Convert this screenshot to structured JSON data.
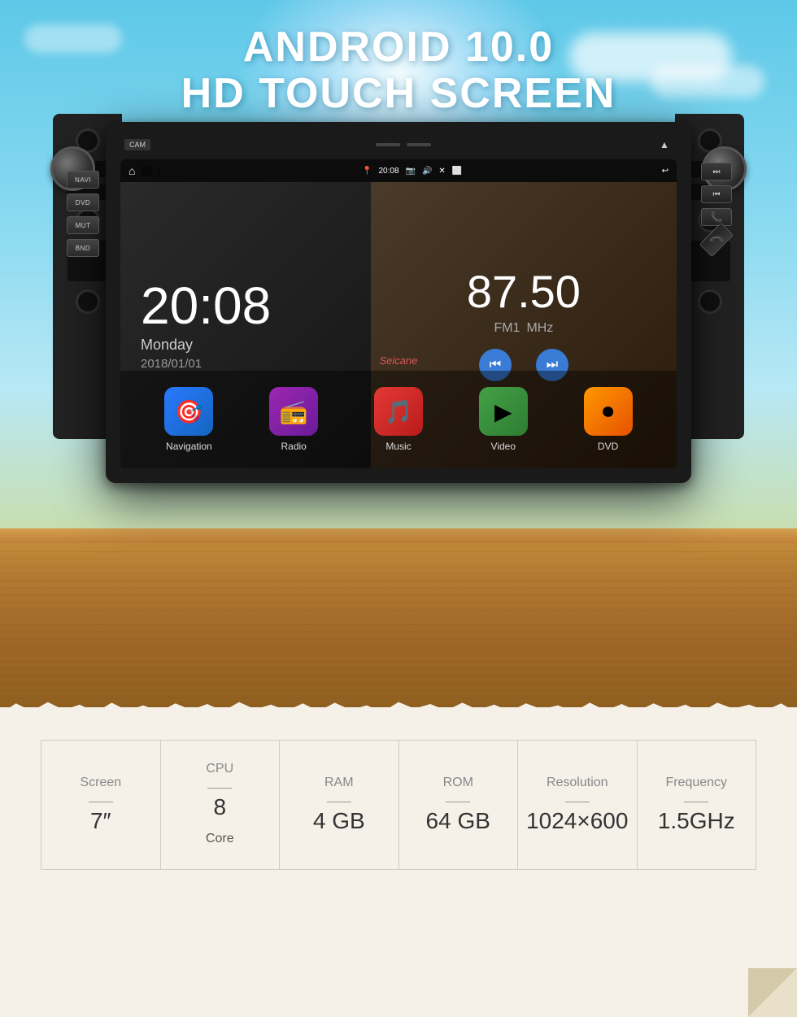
{
  "hero": {
    "title_line1": "ANDROID 10.0",
    "title_line2": "HD TOUCH SCREEN"
  },
  "status_bar": {
    "time": "20:08",
    "icons": [
      "📍",
      "📷",
      "🔊",
      "✕",
      "⬜",
      "↩"
    ]
  },
  "clock": {
    "time": "20:08",
    "day": "Monday",
    "date": "2018/01/01"
  },
  "radio": {
    "frequency": "87.50",
    "band": "FM1",
    "unit": "MHz"
  },
  "apps": [
    {
      "id": "nav",
      "label": "Navigation",
      "icon": "🎯",
      "color_class": "app-icon-nav"
    },
    {
      "id": "radio",
      "label": "Radio",
      "icon": "📻",
      "color_class": "app-icon-radio"
    },
    {
      "id": "music",
      "label": "Music",
      "icon": "🎵",
      "color_class": "app-icon-music"
    },
    {
      "id": "video",
      "label": "Video",
      "icon": "▶",
      "color_class": "app-icon-video"
    },
    {
      "id": "dvd",
      "label": "DVD",
      "icon": "⏺",
      "color_class": "app-icon-dvd"
    }
  ],
  "watermark": "Seicane",
  "buttons_left": [
    "NAVI",
    "DVD",
    "MUT",
    "BND"
  ],
  "buttons_right": [
    "⏭",
    "⏮",
    "📞",
    "📞"
  ],
  "specs": [
    {
      "label": "Screen",
      "value": "7″",
      "extra": ""
    },
    {
      "label": "CPU",
      "value": "8",
      "extra": "Core"
    },
    {
      "label": "RAM",
      "value": "4 GB",
      "extra": ""
    },
    {
      "label": "ROM",
      "value": "64 GB",
      "extra": ""
    },
    {
      "label": "Resolution",
      "value": "1024×600",
      "extra": ""
    },
    {
      "label": "Frequency",
      "value": "1.5GHz",
      "extra": ""
    }
  ]
}
